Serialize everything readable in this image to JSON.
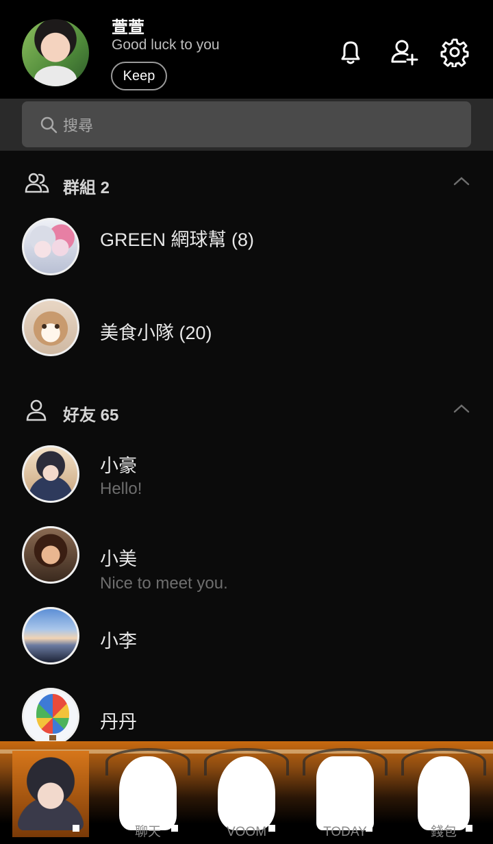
{
  "profile": {
    "name": "萱萱",
    "status": "Good luck to you",
    "keep_label": "Keep"
  },
  "search": {
    "placeholder": "搜尋"
  },
  "groups": {
    "label": "群組 2",
    "items": [
      {
        "name": "GREEN 網球幫 (8)"
      },
      {
        "name": "美食小隊 (20)"
      }
    ]
  },
  "friends": {
    "label": "好友 65",
    "items": [
      {
        "name": "小豪",
        "status": "Hello!"
      },
      {
        "name": "小美",
        "status": "Nice to meet you."
      },
      {
        "name": "小李",
        "status": ""
      },
      {
        "name": "丹丹",
        "status": ""
      }
    ]
  },
  "tabbar": {
    "tabs": [
      {
        "label": ""
      },
      {
        "label": "聊天"
      },
      {
        "label": "VOOM"
      },
      {
        "label": "TODAY"
      },
      {
        "label": "錢包"
      }
    ],
    "active_index": 0
  },
  "colors": {
    "background": "#0b0b0b",
    "header": "#000000",
    "search_band": "#2a2a2a",
    "tab_accent": "#c86a10"
  }
}
